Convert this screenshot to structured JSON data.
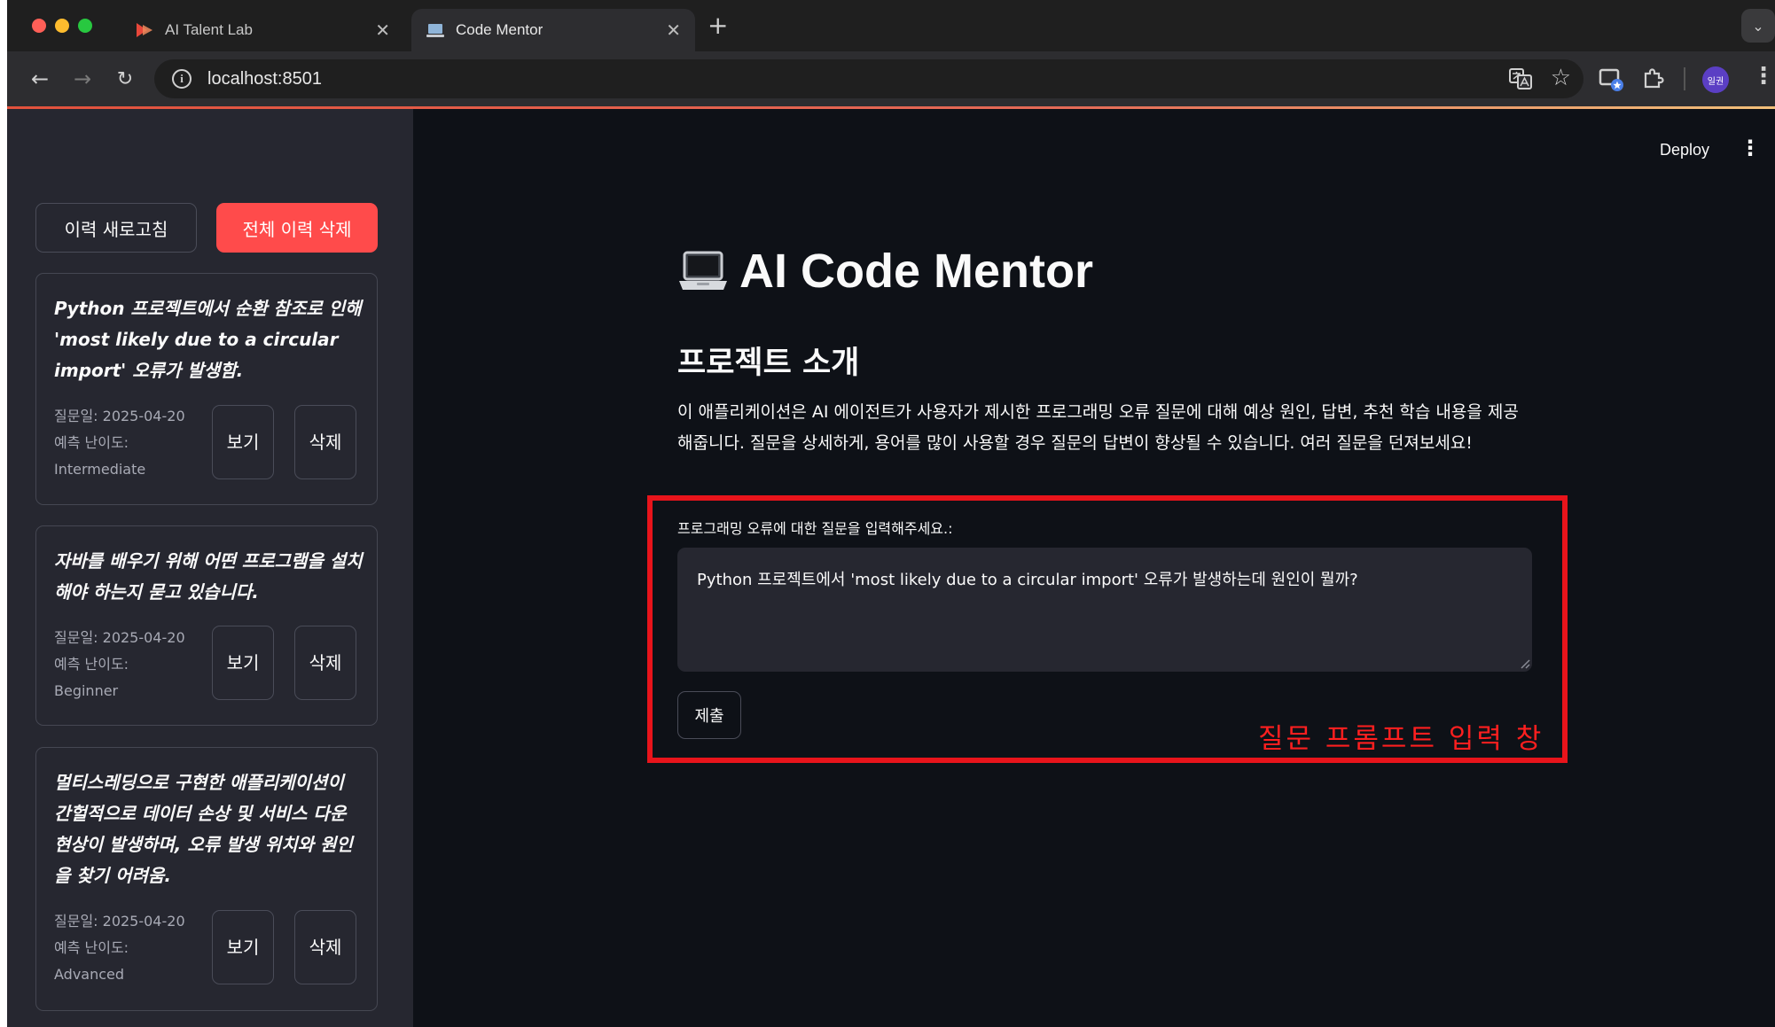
{
  "browser": {
    "tabs": [
      {
        "title": "AI Talent Lab",
        "active": false
      },
      {
        "title": "Code Mentor",
        "active": true
      }
    ],
    "url": "localhost:8501",
    "profile_initials": "일권"
  },
  "app": {
    "header": {
      "deploy_label": "Deploy"
    },
    "title": "AI Code Mentor",
    "title_icon": "laptop-icon",
    "section_heading": "프로젝트 소개",
    "intro": "이 애플리케이션은 AI 에이전트가 사용자가 제시한 프로그래밍 오류 질문에 대해 예상 원인, 답변, 추천 학습 내용을 제공해줍니다. 질문을 상세하게, 용어를 많이 사용할 경우 질문의 답변이 향상될 수 있습니다. 여러 질문을 던져보세요!",
    "form": {
      "label": "프로그래밍 오류에 대한 질문을 입력해주세요.:",
      "value": "Python 프로젝트에서 'most likely due to a circular import' 오류가 발생하는데 원인이 뭘까?",
      "submit_label": "제출"
    },
    "annotation": {
      "label": "질문 프롬프트 입력 창",
      "color": "#e8141b"
    }
  },
  "sidebar": {
    "refresh_label": "이력 새로고침",
    "delete_all_label": "전체 이력 삭제",
    "history": [
      {
        "question": "Python 프로젝트에서 순환 참조로 인해 'most likely due to a circular import' 오류가 발생함.",
        "date": "질문일: 2025-04-20",
        "difficulty_label": "예측 난이도:",
        "difficulty": "Intermediate",
        "view_label": "보기",
        "delete_label": "삭제"
      },
      {
        "question": "자바를 배우기 위해 어떤 프로그램을 설치해야 하는지 묻고 있습니다.",
        "date": "질문일: 2025-04-20",
        "difficulty_label": "예측 난이도:",
        "difficulty": "Beginner",
        "view_label": "보기",
        "delete_label": "삭제"
      },
      {
        "question": "멀티스레딩으로 구현한 애플리케이션이 간헐적으로 데이터 손상 및 서비스 다운 현상이 발생하며, 오류 발생 위치와 원인을 찾기 어려움.",
        "date": "질문일: 2025-04-20",
        "difficulty_label": "예측 난이도:",
        "difficulty": "Advanced",
        "view_label": "보기",
        "delete_label": "삭제"
      }
    ]
  },
  "colors": {
    "primary_button": "#ff4b4b",
    "app_background": "#0e1117",
    "sidebar_background": "#262730",
    "text": "#fafafa"
  }
}
